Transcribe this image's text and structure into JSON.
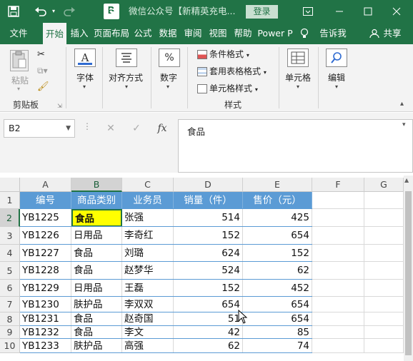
{
  "titlebar": {
    "save_icon": "save-icon",
    "undo_icon": "undo-icon",
    "redo_icon": "redo-icon",
    "user_initial": "B",
    "customize_icon": "chevron-down-icon",
    "doc_title": "微信公众号【新精英充电...",
    "login_label": "登录",
    "restore_icon": "ribbon-display-icon",
    "minimize_icon": "minimize-icon",
    "maximize_icon": "maximize-icon",
    "close_icon": "close-icon",
    "colors": {
      "brand": "#217346",
      "header_fill": "#5b9bd5",
      "highlight": "#ffff00"
    }
  },
  "tabs": [
    {
      "label": "文件"
    },
    {
      "label": "开始"
    },
    {
      "label": "插入"
    },
    {
      "label": "页面布局"
    },
    {
      "label": "公式"
    },
    {
      "label": "数据"
    },
    {
      "label": "审阅"
    },
    {
      "label": "视图"
    },
    {
      "label": "帮助"
    },
    {
      "label": "Power P"
    }
  ],
  "tell_me": "告诉我",
  "share": "共享",
  "ribbon": {
    "clipboard": {
      "paste": "粘贴",
      "group": "剪贴板"
    },
    "font": {
      "label": "字体"
    },
    "align": {
      "label": "对齐方式"
    },
    "number": {
      "label": "数字",
      "icon_text": "%"
    },
    "styles": {
      "conditional": "条件格式",
      "table": "套用表格格式",
      "cell": "单元格样式",
      "group": "样式"
    },
    "cells": {
      "label": "单元格"
    },
    "edit": {
      "label": "编辑"
    }
  },
  "formula_bar": {
    "name_box": "B2",
    "cancel": "✕",
    "enter": "✓",
    "fx": "fx",
    "value": "食品"
  },
  "sheet": {
    "columns": [
      "A",
      "B",
      "C",
      "D",
      "E",
      "F",
      "G"
    ],
    "rows": [
      "1",
      "2",
      "3",
      "4",
      "5",
      "6",
      "7",
      "8",
      "9",
      "10"
    ],
    "headers": [
      "编号",
      "商品类别",
      "业务员",
      "销量（件）",
      "售价（元）"
    ],
    "data": [
      [
        "YB1225",
        "食品",
        "张强",
        "514",
        "425"
      ],
      [
        "YB1226",
        "日用品",
        "李奇红",
        "152",
        "654"
      ],
      [
        "YB1227",
        "食品",
        "刘璐",
        "624",
        "152"
      ],
      [
        "YB1228",
        "食品",
        "赵梦华",
        "524",
        "62"
      ],
      [
        "YB1229",
        "日用品",
        "王磊",
        "152",
        "452"
      ],
      [
        "YB1230",
        "肤护品",
        "李双双",
        "654",
        "654"
      ],
      [
        "YB1231",
        "食品",
        "赵奇国",
        "51",
        "654"
      ],
      [
        "YB1232",
        "食品",
        "李文",
        "42",
        "85"
      ],
      [
        "YB1233",
        "肤护品",
        "高强",
        "62",
        "74"
      ]
    ]
  }
}
